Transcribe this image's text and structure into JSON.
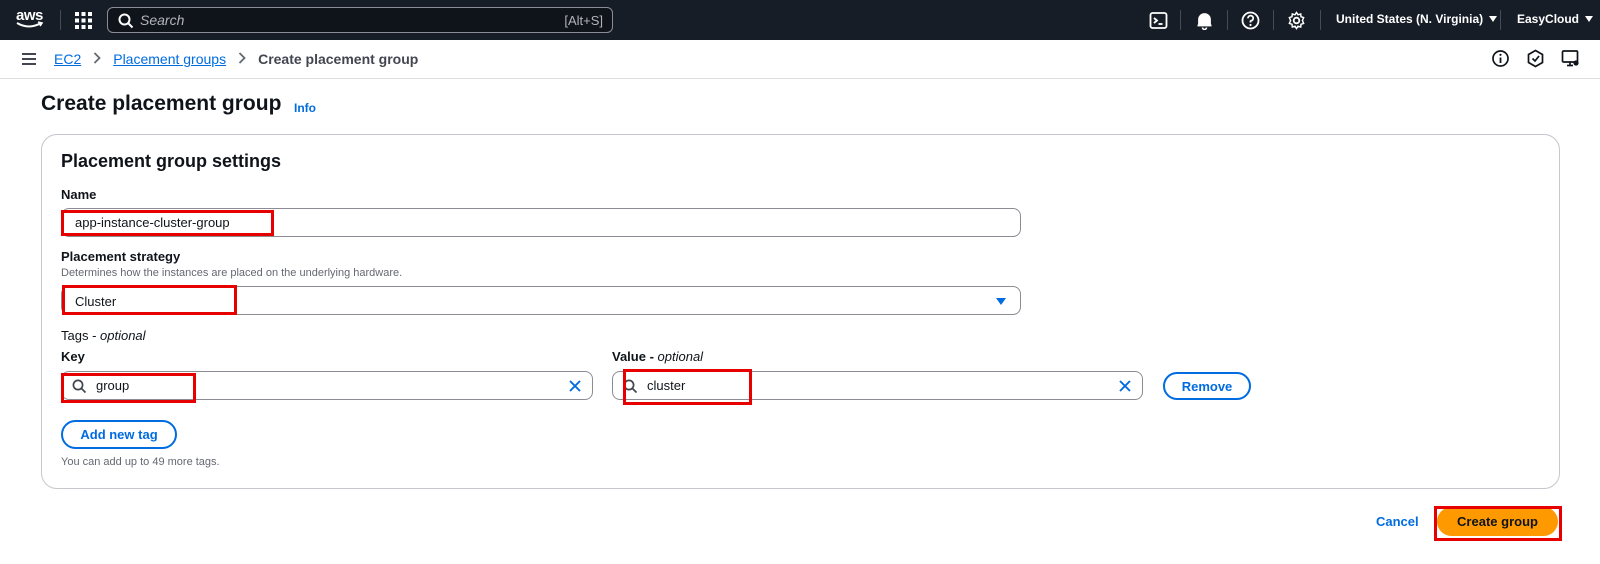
{
  "topnav": {
    "search_placeholder": "Search",
    "search_shortcut": "[Alt+S]",
    "region": "United States (N. Virginia)",
    "account": "EasyCloud",
    "icons": [
      "cloudshell-icon",
      "notifications-icon",
      "help-icon",
      "settings-icon"
    ]
  },
  "breadcrumb": {
    "items": [
      "EC2",
      "Placement groups"
    ],
    "current": "Create placement group"
  },
  "page": {
    "title": "Create placement group",
    "info": "Info"
  },
  "form": {
    "section_title": "Placement group settings",
    "name_label": "Name",
    "name_value": "app-instance-cluster-group",
    "strategy_label": "Placement strategy",
    "strategy_desc": "Determines how the instances are placed on the underlying hardware.",
    "strategy_value": "Cluster",
    "tags_label": "Tags - ",
    "tags_optional": "optional",
    "key_label": "Key",
    "key_value": "group",
    "value_label": "Value - ",
    "value_optional": "optional",
    "value_value": "cluster",
    "remove_label": "Remove",
    "add_tag_label": "Add new tag",
    "tags_helper": "You can add up to 49 more tags."
  },
  "actions": {
    "cancel": "Cancel",
    "create": "Create group"
  },
  "colors": {
    "nav_bg": "#161d26",
    "link": "#006ce0",
    "primary_button": "#ff9900",
    "annotation": "#e60000"
  }
}
